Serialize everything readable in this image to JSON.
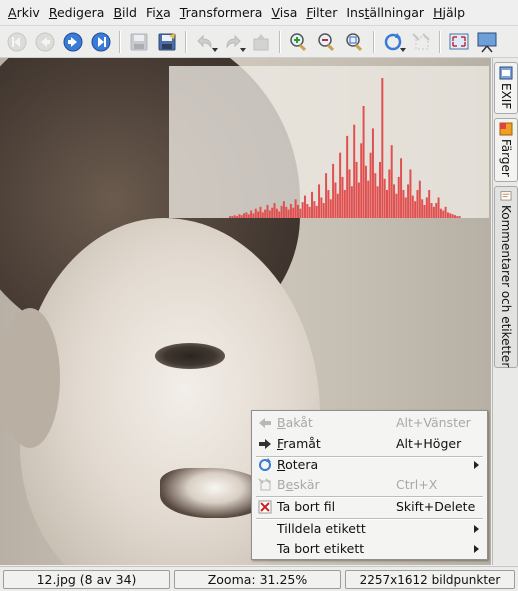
{
  "menubar": {
    "items": [
      {
        "pre": "",
        "u": "A",
        "post": "rkiv"
      },
      {
        "pre": "",
        "u": "R",
        "post": "edigera"
      },
      {
        "pre": "",
        "u": "B",
        "post": "ild"
      },
      {
        "pre": "Fi",
        "u": "x",
        "post": "a"
      },
      {
        "pre": "",
        "u": "T",
        "post": "ransformera"
      },
      {
        "pre": "",
        "u": "V",
        "post": "isa"
      },
      {
        "pre": "",
        "u": "F",
        "post": "ilter"
      },
      {
        "pre": "Ins",
        "u": "t",
        "post": "ällningar"
      },
      {
        "pre": "",
        "u": "H",
        "post": "jälp"
      }
    ]
  },
  "toolbar": {
    "buttons": [
      "first-icon",
      "back-icon",
      "forward-icon",
      "last-icon",
      "save-icon",
      "save-as-icon",
      "undo-icon",
      "redo-icon",
      "revert-icon",
      "zoom-in-icon",
      "zoom-out-icon",
      "zoom-fit-icon",
      "rotate-icon",
      "crop-icon",
      "fullscreen-icon",
      "slideshow-icon"
    ]
  },
  "sidebar": {
    "tabs": [
      "EXIF",
      "Färger",
      "Kommentarer och etiketter"
    ]
  },
  "histogram": {
    "color": "#e05050",
    "values": [
      2,
      2,
      3,
      2,
      4,
      3,
      5,
      6,
      4,
      8,
      5,
      10,
      7,
      12,
      6,
      9,
      14,
      8,
      11,
      16,
      10,
      7,
      13,
      18,
      12,
      9,
      15,
      11,
      20,
      14,
      10,
      17,
      24,
      15,
      12,
      28,
      18,
      13,
      36,
      22,
      16,
      48,
      30,
      20,
      58,
      38,
      26,
      70,
      44,
      30,
      88,
      52,
      34,
      100,
      60,
      38,
      80,
      120,
      56,
      40,
      70,
      96,
      48,
      34,
      60,
      150,
      42,
      30,
      52,
      78,
      36,
      26,
      44,
      64,
      30,
      22,
      36,
      52,
      24,
      18,
      30,
      40,
      20,
      14,
      22,
      30,
      16,
      12,
      16,
      22,
      10,
      8,
      12,
      6,
      5,
      4,
      3,
      2,
      2
    ]
  },
  "context_menu": {
    "items": [
      {
        "type": "item",
        "icon": "back-arrow-icon",
        "pre": "",
        "u": "B",
        "post": "akåt",
        "shortcut": "Alt+Vänster",
        "disabled": true
      },
      {
        "type": "item",
        "icon": "forward-arrow-icon",
        "pre": "",
        "u": "F",
        "post": "ramåt",
        "shortcut": "Alt+Höger",
        "disabled": false
      },
      {
        "type": "sep"
      },
      {
        "type": "item",
        "icon": "rotate-icon",
        "pre": "",
        "u": "R",
        "post": "otera",
        "shortcut": "",
        "submenu": true,
        "disabled": false
      },
      {
        "type": "item",
        "icon": "crop-icon",
        "pre": "B",
        "u": "e",
        "post": "skär",
        "shortcut": "Ctrl+X",
        "disabled": true
      },
      {
        "type": "sep"
      },
      {
        "type": "item",
        "icon": "delete-icon",
        "pre": "Ta bort fil",
        "u": "",
        "post": "",
        "shortcut": "Skift+Delete",
        "disabled": false
      },
      {
        "type": "sep"
      },
      {
        "type": "item",
        "icon": "",
        "pre": "Tilldela etikett",
        "u": "",
        "post": "",
        "shortcut": "",
        "submenu": true,
        "disabled": false
      },
      {
        "type": "item",
        "icon": "",
        "pre": "Ta bort etikett",
        "u": "",
        "post": "",
        "shortcut": "",
        "submenu": true,
        "disabled": false
      }
    ]
  },
  "statusbar": {
    "file": "12.jpg (8 av 34)",
    "zoom": "Zooma: 31.25%",
    "size": "2257x1612 bildpunkter"
  }
}
